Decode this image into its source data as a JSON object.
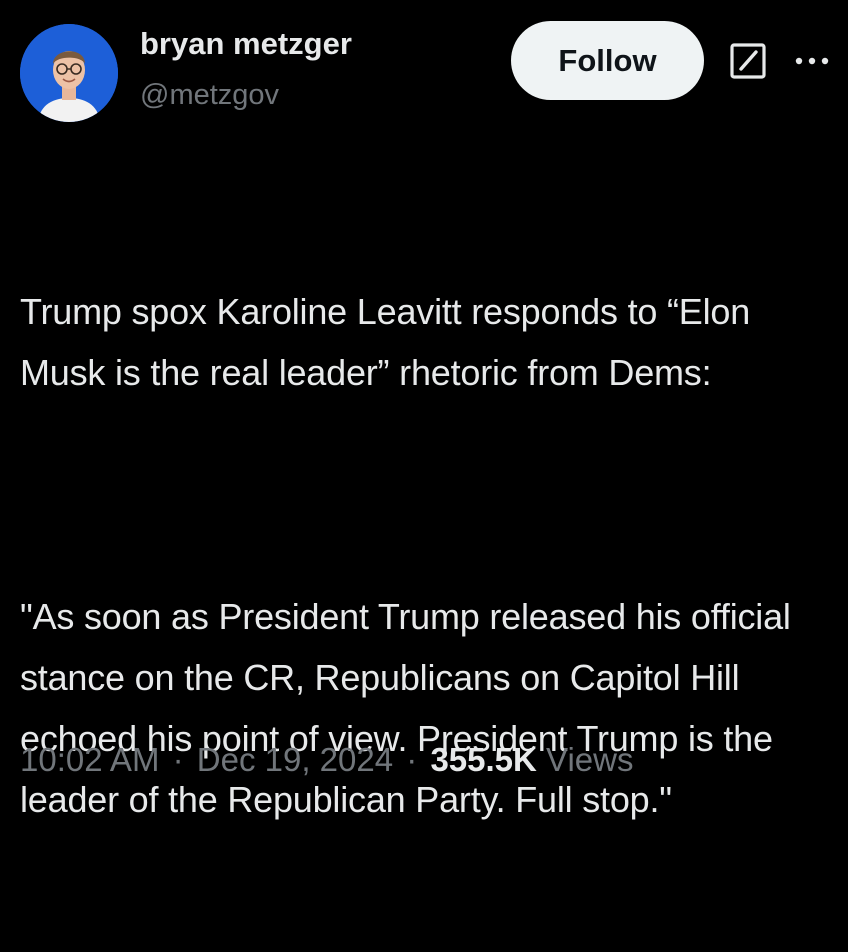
{
  "tweet": {
    "author": {
      "display_name": "bryan metzger",
      "handle": "@metzgov",
      "avatar_icon": "profile-photo"
    },
    "follow_label": "Follow",
    "header_icons": [
      "grok-icon",
      "more-options-icon"
    ],
    "text_paragraph_1": "Trump spox Karoline Leavitt responds to “Elon Musk is the real leader” rhetoric from Dems:",
    "text_paragraph_2": "\"As soon as President Trump released his official stance on the CR, Republicans on Capitol Hill echoed his point of view. President Trump is the leader of the Republican Party. Full stop.\"",
    "time": "10:02 AM",
    "date": "Dec 19, 2024",
    "separator": "·",
    "views_count": "355.5K",
    "views_label": "Views"
  },
  "colors": {
    "background": "#000000",
    "primary_text": "#e7e9ea",
    "secondary_text": "#71767b",
    "follow_button_bg": "#eff3f4",
    "avatar_bg": "#1d5fd8"
  }
}
